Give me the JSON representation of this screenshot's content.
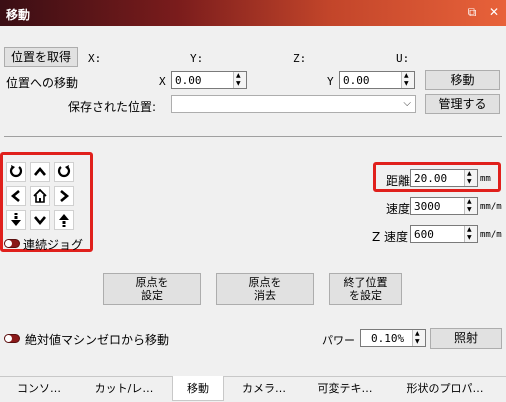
{
  "window": {
    "title": "移動",
    "restore_icon": "⧉",
    "close_icon": "✕"
  },
  "position": {
    "get_button": "位置を取得",
    "x_label": "X:",
    "y_label": "Y:",
    "z_label": "Z:",
    "u_label": "U:"
  },
  "move_to": {
    "label": "位置への移動",
    "x_label": "X",
    "x_value": "0.00",
    "y_label": "Y",
    "y_value": "0.00",
    "move_button": "移動"
  },
  "saved": {
    "label": "保存された位置:",
    "value": "",
    "manage_button": "管理する"
  },
  "jog": {
    "continuous_label": "連続ジョグ"
  },
  "distance": {
    "label": "距離",
    "value": "20.00",
    "unit": "mm"
  },
  "speed": {
    "label": "速度",
    "value": "3000",
    "unit": "mm/m"
  },
  "z_speed": {
    "label": "Z 速度",
    "value": "600",
    "unit": "mm/m"
  },
  "buttons": {
    "set_origin": [
      "原点を",
      "設定"
    ],
    "clear_origin": [
      "原点を",
      "消去"
    ],
    "set_finish": [
      "終了位置",
      "を設定"
    ]
  },
  "absolute_zero": {
    "label": "絶対値マシンゼロから移動"
  },
  "power": {
    "label": "パワー",
    "value": "0.10%",
    "fire_button": "照射"
  },
  "tabs": [
    "コンソ…",
    "カット/レ…",
    "移動",
    "カメラ…",
    "可変テキ…",
    "形状のプロパ…"
  ],
  "colors": {
    "highlight": "#e0201c",
    "title_start": "#3a0e14",
    "title_end": "#e8623a"
  }
}
